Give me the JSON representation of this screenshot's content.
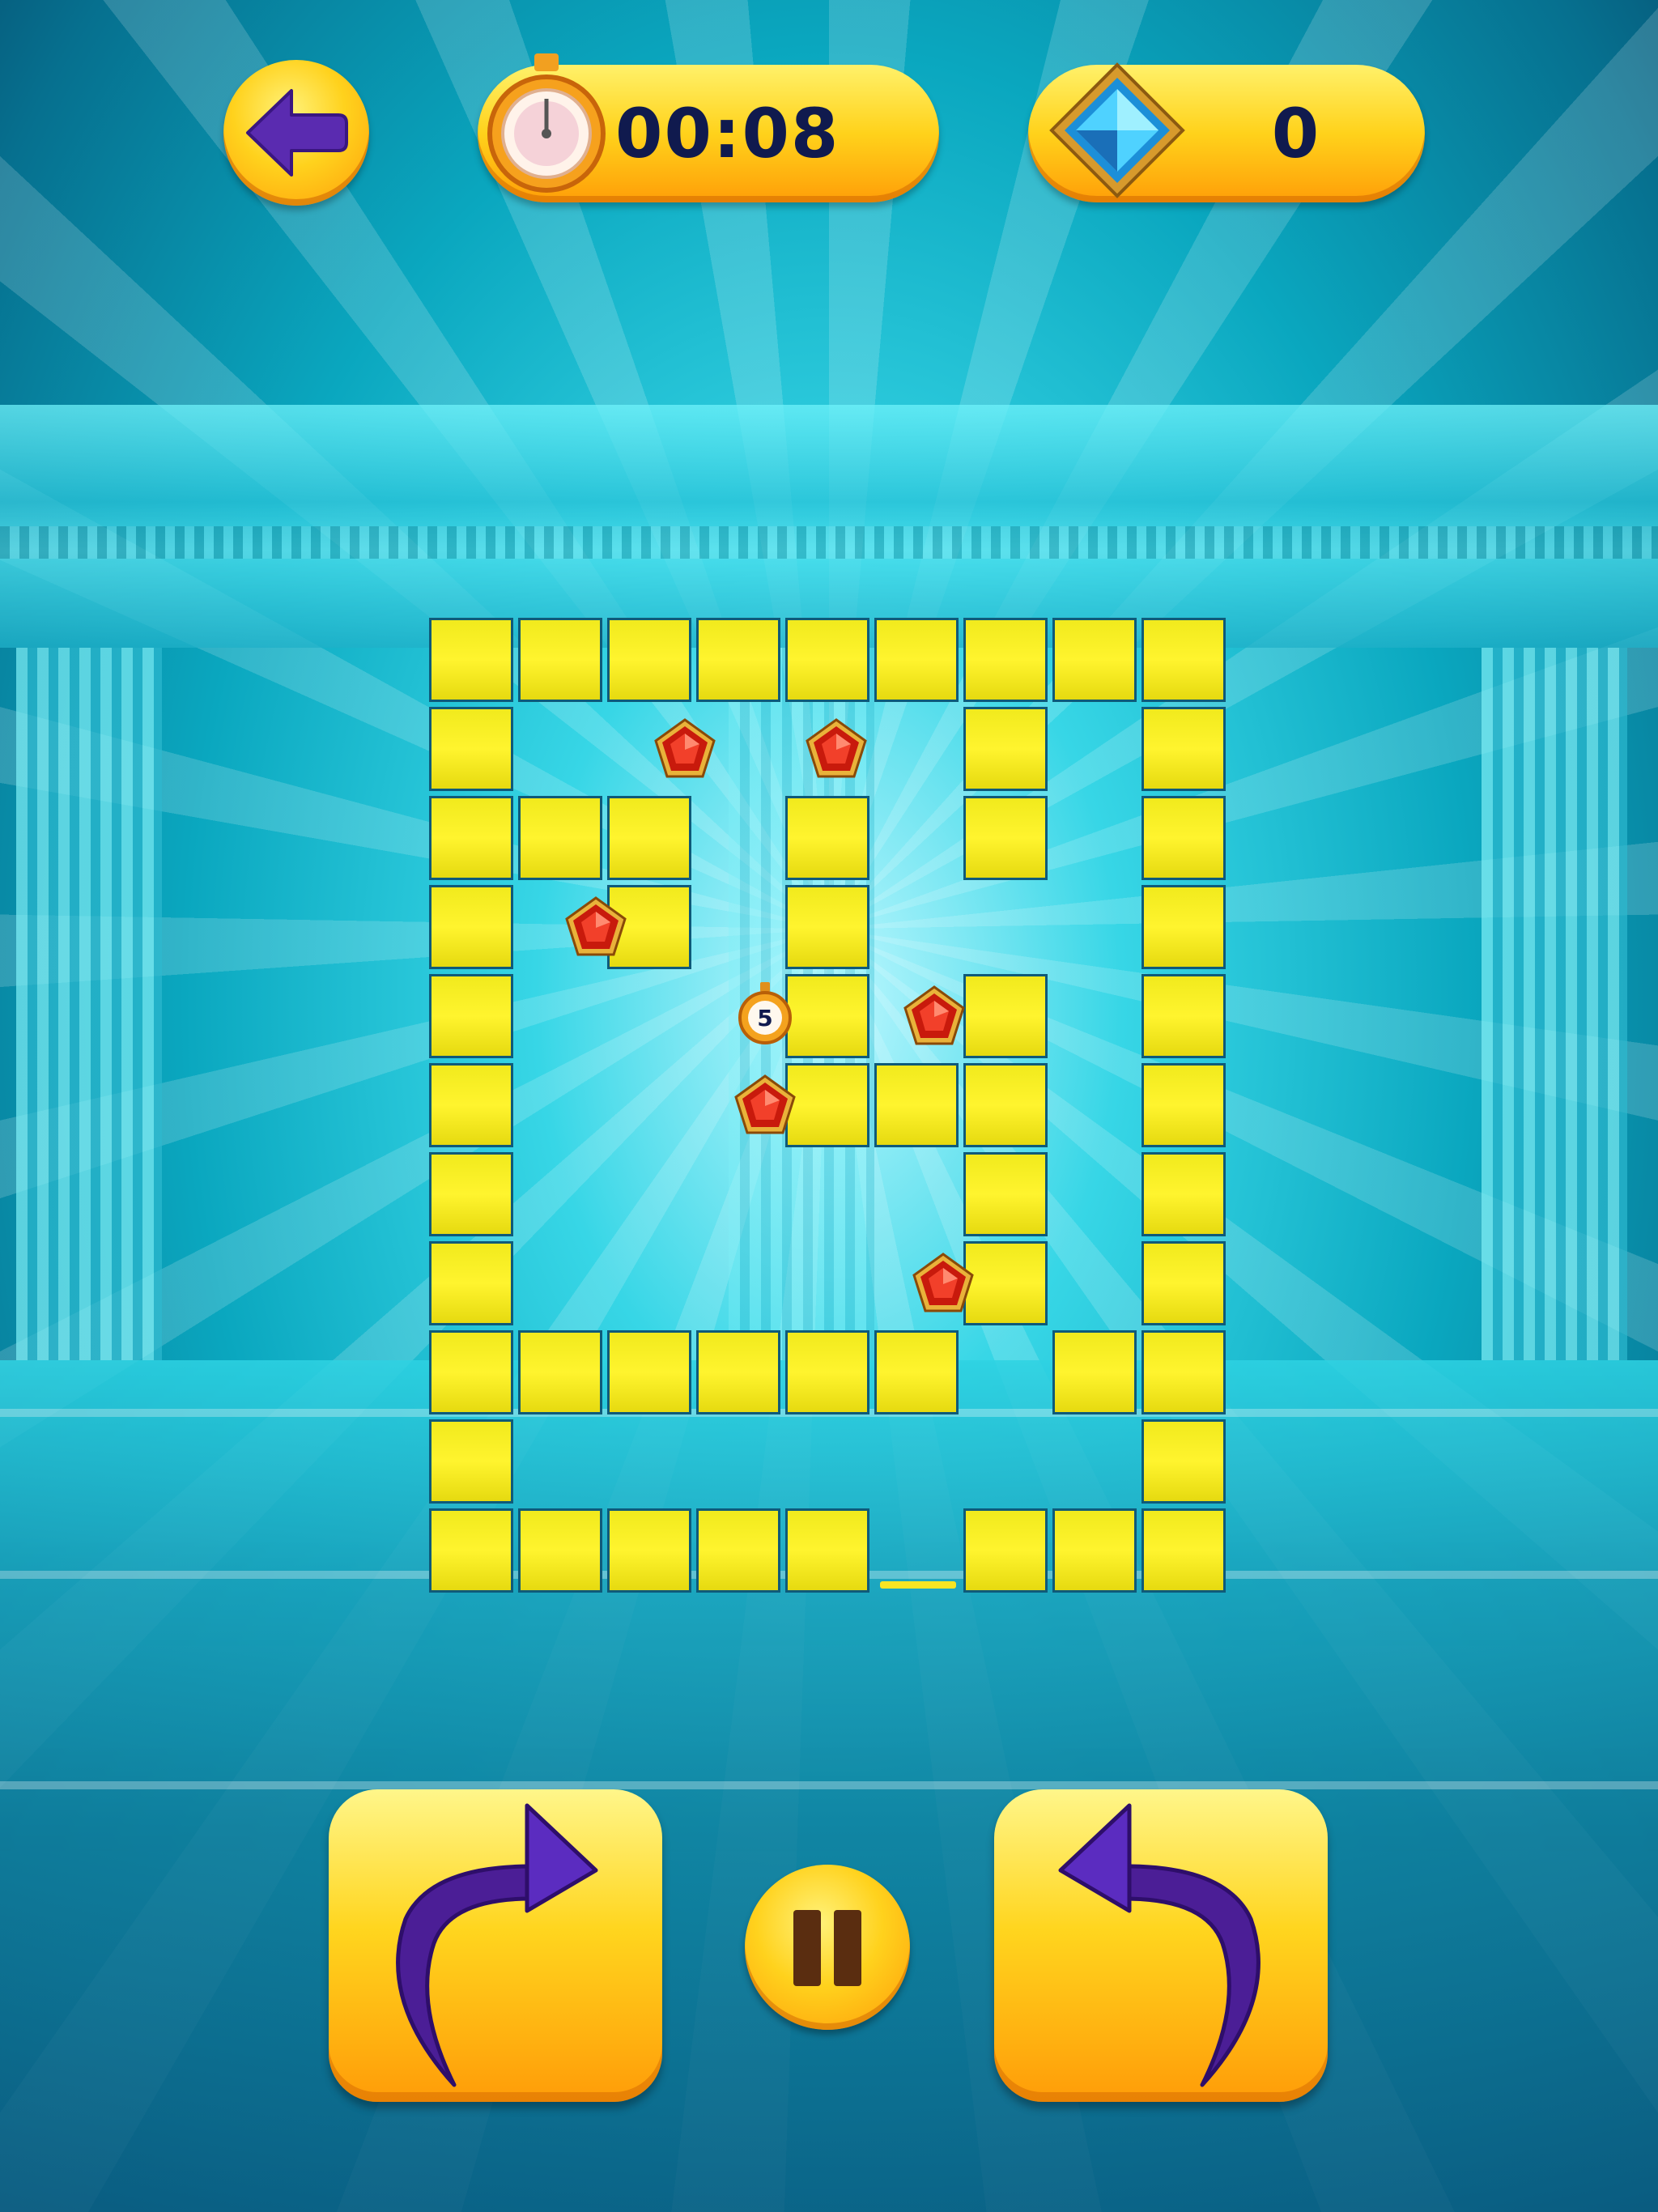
{
  "hud": {
    "timer": "00:08",
    "gem_count": "0"
  },
  "board": {
    "rows": 11,
    "cols": 9,
    "walls": [
      [
        0,
        0
      ],
      [
        0,
        1
      ],
      [
        0,
        2
      ],
      [
        0,
        3
      ],
      [
        0,
        4
      ],
      [
        0,
        5
      ],
      [
        0,
        6
      ],
      [
        0,
        7
      ],
      [
        0,
        8
      ],
      [
        1,
        0
      ],
      [
        1,
        6
      ],
      [
        1,
        8
      ],
      [
        2,
        0
      ],
      [
        2,
        1
      ],
      [
        2,
        2
      ],
      [
        2,
        4
      ],
      [
        2,
        6
      ],
      [
        2,
        8
      ],
      [
        3,
        0
      ],
      [
        3,
        2
      ],
      [
        3,
        4
      ],
      [
        3,
        8
      ],
      [
        4,
        0
      ],
      [
        4,
        4
      ],
      [
        4,
        6
      ],
      [
        4,
        8
      ],
      [
        5,
        0
      ],
      [
        5,
        4
      ],
      [
        5,
        5
      ],
      [
        5,
        6
      ],
      [
        5,
        8
      ],
      [
        6,
        0
      ],
      [
        6,
        6
      ],
      [
        6,
        8
      ],
      [
        7,
        0
      ],
      [
        7,
        6
      ],
      [
        7,
        8
      ],
      [
        8,
        0
      ],
      [
        8,
        1
      ],
      [
        8,
        2
      ],
      [
        8,
        3
      ],
      [
        8,
        4
      ],
      [
        8,
        5
      ],
      [
        8,
        7
      ],
      [
        8,
        8
      ],
      [
        9,
        0
      ],
      [
        9,
        8
      ],
      [
        10,
        0
      ],
      [
        10,
        1
      ],
      [
        10,
        2
      ],
      [
        10,
        3
      ],
      [
        10,
        4
      ],
      [
        10,
        6
      ],
      [
        10,
        7
      ],
      [
        10,
        8
      ]
    ],
    "rubies": [
      {
        "row": 1,
        "col": 2.4
      },
      {
        "row": 1,
        "col": 4.1
      },
      {
        "row": 3,
        "col": 1.4
      },
      {
        "row": 4,
        "col": 5.2
      },
      {
        "row": 5,
        "col": 3.3
      },
      {
        "row": 7,
        "col": 5.3
      }
    ],
    "bomb": {
      "row": 4,
      "col": 3.3,
      "label": "5"
    }
  },
  "colors": {
    "wall": "#f6ee22",
    "wall_border": "#0f5a79",
    "button": "#ffd21d",
    "arrow": "#5a2bb0",
    "ruby": "#d8200c",
    "text": "#101a4e"
  },
  "icons": {
    "back": "back-arrow-icon",
    "timer": "stopwatch-icon",
    "gems": "blue-gem-icon",
    "rotate_cw": "rotate-clockwise-icon",
    "rotate_ccw": "rotate-counterclockwise-icon",
    "pause": "pause-icon"
  }
}
